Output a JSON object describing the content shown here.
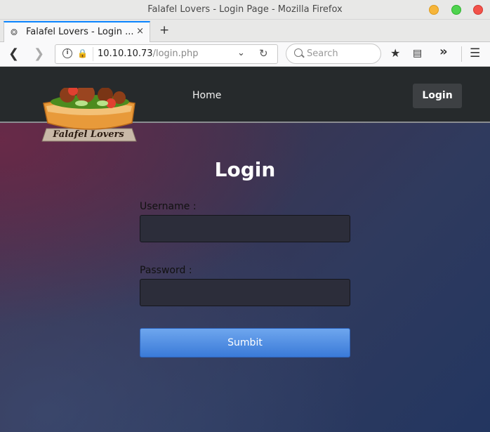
{
  "window": {
    "title": "Falafel Lovers - Login Page - Mozilla Firefox"
  },
  "tab": {
    "label": "Falafel Lovers - Login ...",
    "close": "×",
    "new_tab": "+"
  },
  "navbar": {
    "url_host": "10.10.10.73",
    "url_path": "/login.php",
    "search_placeholder": "Search"
  },
  "site": {
    "logo_text": "Falafel Lovers",
    "nav_home": "Home",
    "nav_login": "Login"
  },
  "form": {
    "title": "Login",
    "username_label": "Username :",
    "username_value": "",
    "password_label": "Password :",
    "password_value": "",
    "submit_label": "Sumbit"
  },
  "icons": {
    "back": "back-arrow-icon",
    "forward": "forward-arrow-icon",
    "info": "info-icon",
    "insecure": "insecure-lock-icon",
    "reload": "reload-icon",
    "search": "search-icon",
    "bookmark": "star-icon",
    "library": "library-icon",
    "overflow": "overflow-chevrons-icon",
    "menu": "hamburger-menu-icon"
  },
  "colors": {
    "submit_button": "#4a8ae0",
    "site_header": "#262a2c",
    "tab_accent": "#0a84ff"
  }
}
